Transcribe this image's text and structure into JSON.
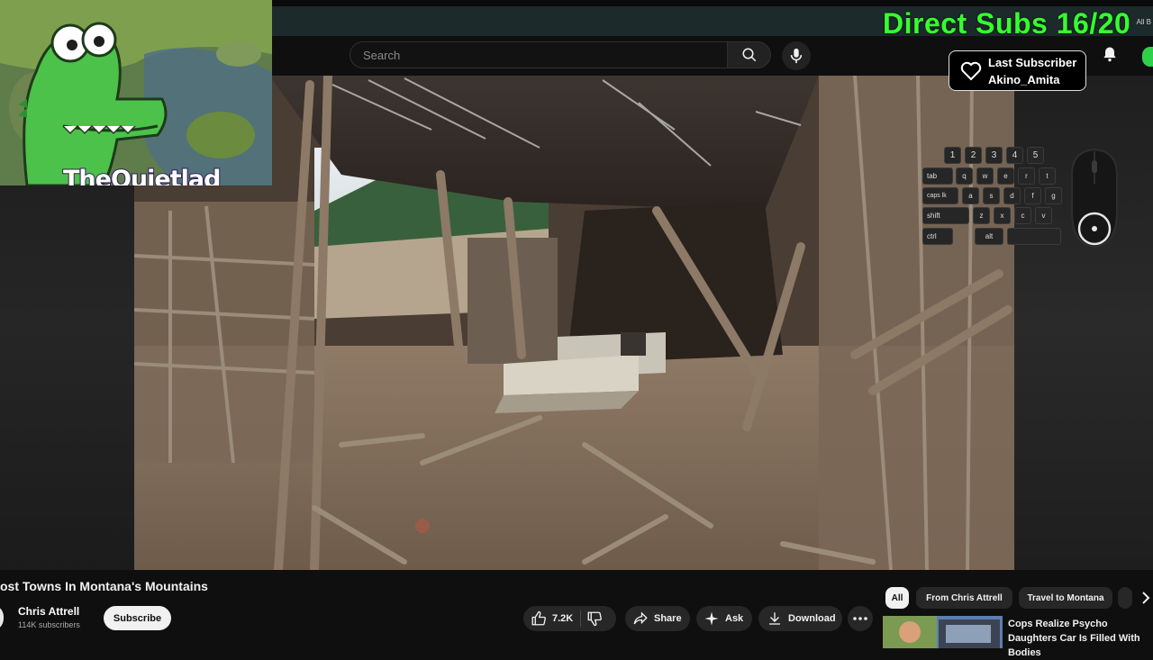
{
  "overlay": {
    "subs_goal": "Direct Subs 16/20",
    "last_subscriber_title": "Last Subscriber",
    "last_subscriber_name": "Akino_Amita",
    "cam_name": "TheQuietlad",
    "corner_text": "All B"
  },
  "header": {
    "search_placeholder": "Search"
  },
  "keyboard": {
    "row1": [
      "1",
      "2",
      "3",
      "4",
      "5"
    ],
    "row2": [
      "tab",
      "q",
      "w",
      "e",
      "r",
      "t"
    ],
    "row3": [
      "caps lk",
      "a",
      "s",
      "d",
      "f",
      "g"
    ],
    "row4": [
      "shift",
      "z",
      "x",
      "c",
      "v"
    ],
    "row5": [
      "ctrl",
      "alt"
    ]
  },
  "video": {
    "title": "ost Towns In Montana's Mountains",
    "channel": "Chris Attrell",
    "subscribers": "114K subscribers",
    "subscribe_label": "Subscribe",
    "likes": "7.2K",
    "share_label": "Share",
    "ask_label": "Ask",
    "download_label": "Download"
  },
  "sidebar": {
    "chips": [
      "All",
      "From Chris Attrell",
      "Travel to Montana"
    ],
    "rec_title": "Cops Realize Psycho Daughters Car Is Filled With Bodies"
  },
  "colors": {
    "goal_green": "#36ff2f",
    "bg": "#0f0f0f"
  }
}
